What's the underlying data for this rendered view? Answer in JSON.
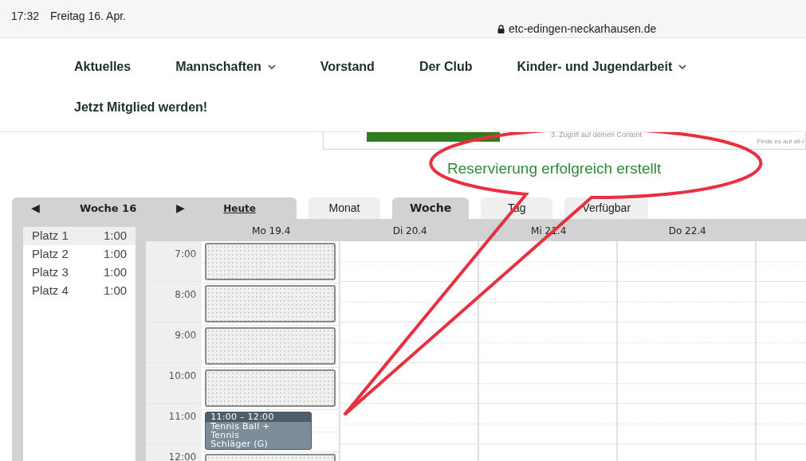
{
  "status_bar": {
    "time": "17:32",
    "date": "Freitag 16. Apr.",
    "url": "etc-edingen-neckarhausen.de"
  },
  "nav": {
    "items": [
      {
        "label": "Aktuelles",
        "dropdown": false
      },
      {
        "label": "Mannschaften",
        "dropdown": true
      },
      {
        "label": "Vorstand",
        "dropdown": false
      },
      {
        "label": "Der Club",
        "dropdown": false
      },
      {
        "label": "Kinder- und Jugendarbeit",
        "dropdown": true
      }
    ],
    "cta": "Jetzt Mitglied werden!"
  },
  "ad_fragment": {
    "text": "3. Zugriff auf deinen Content",
    "note": "Finde es auf all-i"
  },
  "message": "Reservierung erfolgreich erstellt",
  "calendar": {
    "prev": "◀",
    "week": "Woche 16",
    "next": "▶",
    "today": "Heute",
    "tabs": [
      {
        "label": "Monat",
        "selected": false
      },
      {
        "label": "Woche",
        "selected": true
      },
      {
        "label": "Tag",
        "selected": false
      },
      {
        "label": "Verfügbar",
        "selected": false
      }
    ],
    "courts": [
      {
        "name": "Platz 1",
        "duration": "1:00",
        "selected": true
      },
      {
        "name": "Platz 2",
        "duration": "1:00",
        "selected": false
      },
      {
        "name": "Platz 3",
        "duration": "1:00",
        "selected": false
      },
      {
        "name": "Platz 4",
        "duration": "1:00",
        "selected": false
      }
    ],
    "hours": [
      "7:00",
      "8:00",
      "9:00",
      "10:00",
      "11:00",
      "12:00"
    ],
    "days": [
      {
        "label": "Mo 19.4",
        "slots": [
          {
            "kind": "blocked"
          },
          {
            "kind": "blocked"
          },
          {
            "kind": "blocked"
          },
          {
            "kind": "blocked"
          },
          {
            "kind": "booking",
            "time": "11:00 – 12:00",
            "title": "Tennis Ball + Tennis Schläger (G)"
          },
          {
            "kind": "blocked"
          }
        ]
      },
      {
        "label": "Di 20.4"
      },
      {
        "label": "Mi 21.4"
      },
      {
        "label": "Do 22.4"
      }
    ]
  }
}
